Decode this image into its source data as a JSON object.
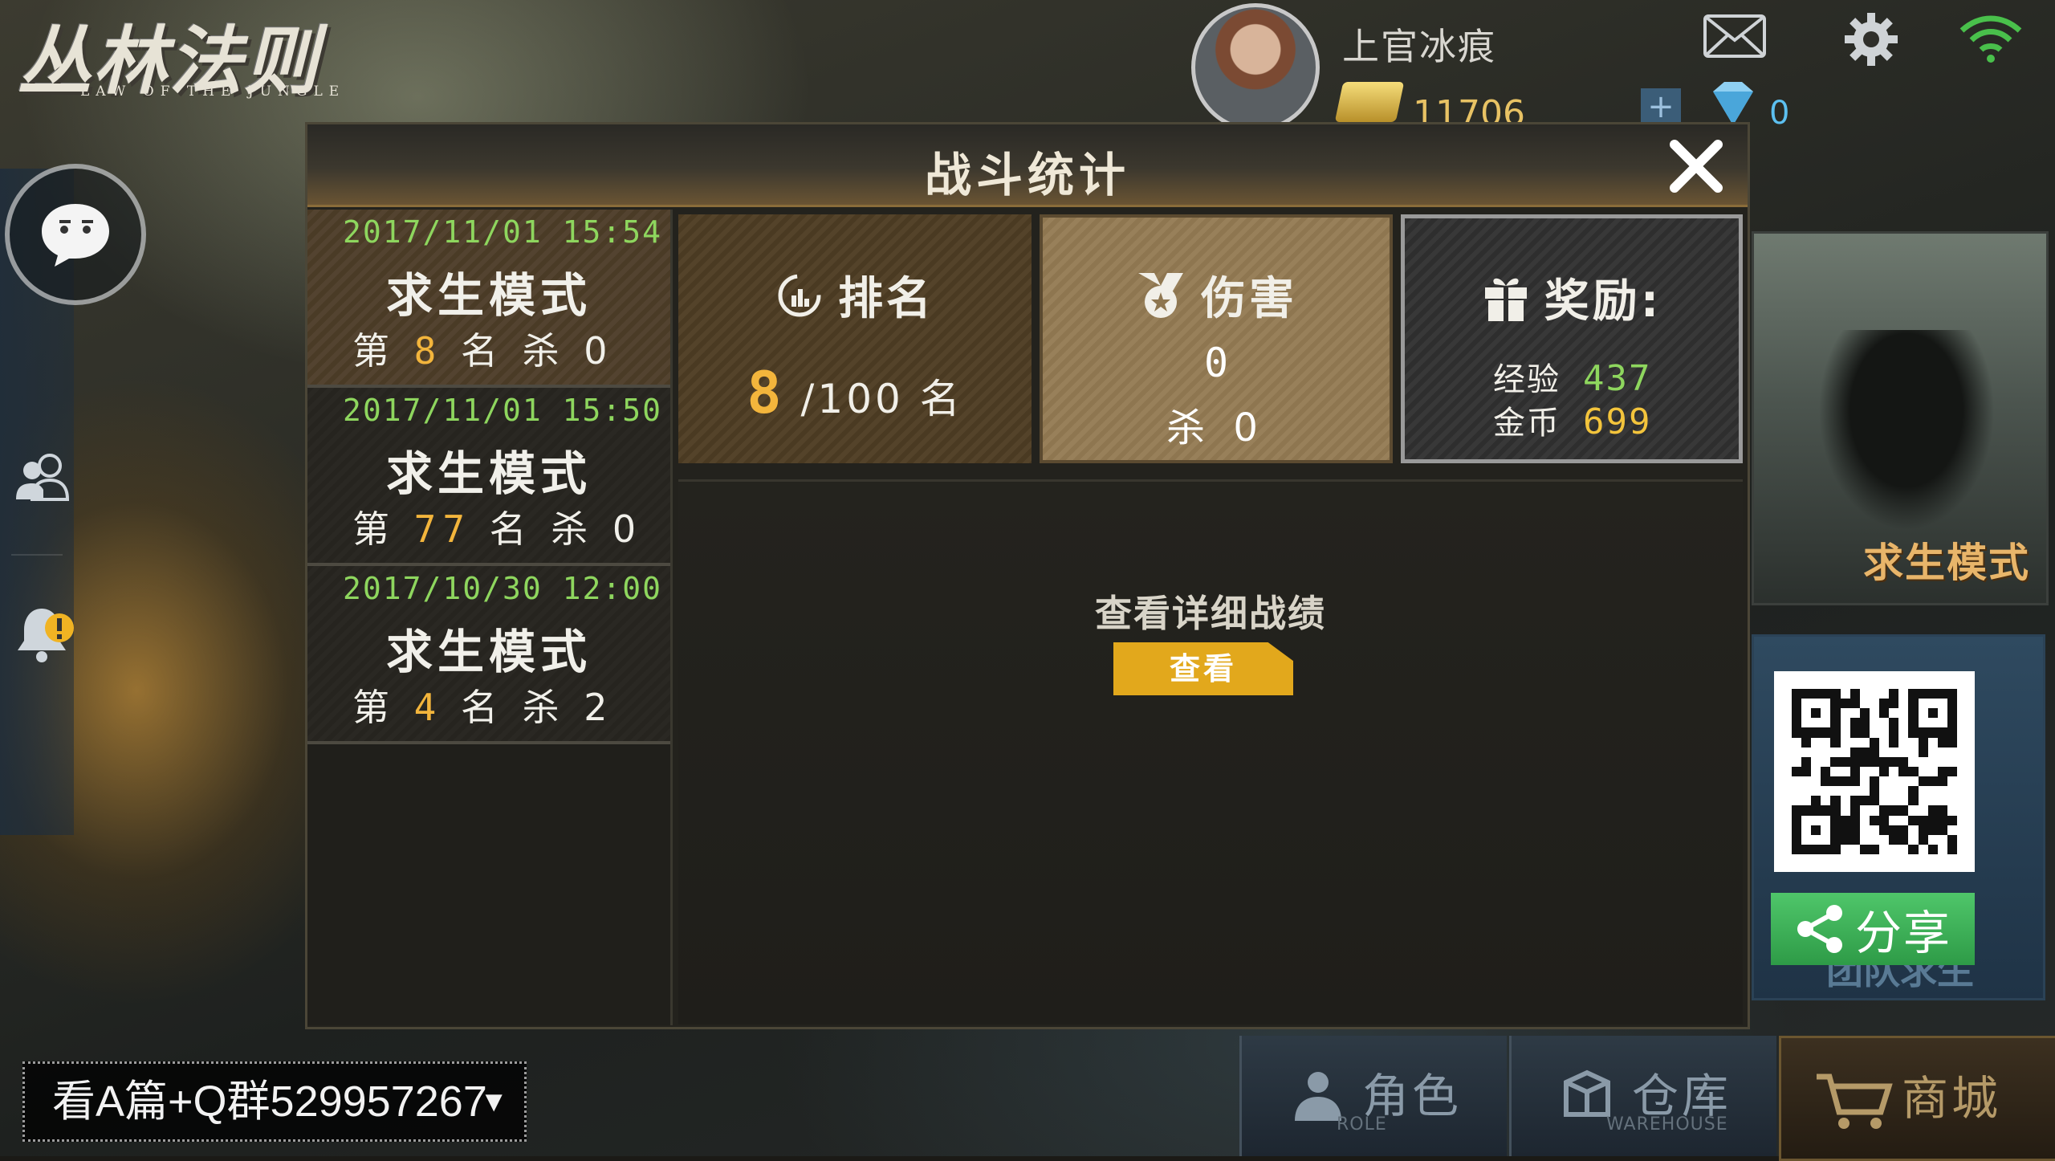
{
  "logo": {
    "title": "丛林法则",
    "subtitle": "LAW OF THE JUNGLE"
  },
  "topbar": {
    "player_name": "上官冰痕",
    "gold": "11706",
    "plus": "+",
    "diamonds": "0"
  },
  "dialog": {
    "title": "战斗统计",
    "records": [
      {
        "date": "2017/11/01 15:54",
        "mode": "求生模式",
        "rank_prefix": "第",
        "rank": "8",
        "rank_suffix": "名",
        "kill_label": "杀",
        "kills": "0"
      },
      {
        "date": "2017/11/01 15:50",
        "mode": "求生模式",
        "rank_prefix": "第",
        "rank": "77",
        "rank_suffix": "名",
        "kill_label": "杀",
        "kills": "0"
      },
      {
        "date": "2017/10/30 12:00",
        "mode": "求生模式",
        "rank_prefix": "第",
        "rank": "4",
        "rank_suffix": "名",
        "kill_label": "杀",
        "kills": "2"
      }
    ],
    "rank_box": {
      "label": "排名",
      "value": "8",
      "total": "/100 名"
    },
    "damage_box": {
      "label": "伤害",
      "value": "0",
      "kill_label": "杀",
      "kills": "0"
    },
    "reward_box": {
      "label": "奖励:",
      "exp_label": "经验",
      "exp": "437",
      "gold_label": "金币",
      "gold": "699"
    },
    "detail_label": "查看详细战绩",
    "view_button": "查看"
  },
  "right_panel": {
    "mode_label": "求生模式",
    "team_label": "团队求生",
    "share_button": "分享"
  },
  "bottom_nav": [
    {
      "label": "角色",
      "en": "ROLE"
    },
    {
      "label": "仓库",
      "en": "WAREHOUSE"
    },
    {
      "label": "商城",
      "en": ""
    }
  ],
  "promo": {
    "text": "看A篇+Q群529957267"
  },
  "colors": {
    "accent_green": "#8ed65e",
    "accent_gold": "#f3b53c",
    "button_gold": "#e2a81c",
    "share_green": "#3fb35a"
  },
  "icons": [
    "chat-icon",
    "friends-icon",
    "alert-bell-icon",
    "mail-icon",
    "gear-icon",
    "wifi-icon",
    "gold-bar-icon",
    "diamond-icon",
    "close-icon",
    "rank-icon",
    "medal-icon",
    "gift-icon",
    "share-icon",
    "role-icon",
    "warehouse-icon",
    "cart-icon"
  ]
}
